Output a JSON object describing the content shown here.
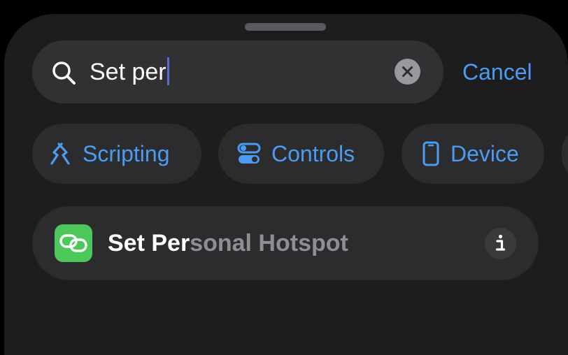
{
  "search": {
    "query": "Set per",
    "clear_icon": "xmark-circle-icon",
    "search_icon": "magnifyingglass-icon"
  },
  "header": {
    "cancel_label": "Cancel"
  },
  "categories": [
    {
      "label": "Scripting",
      "icon": "scripting-icon"
    },
    {
      "label": "Controls",
      "icon": "toggles-icon"
    },
    {
      "label": "Device",
      "icon": "phone-icon"
    }
  ],
  "results": [
    {
      "title_match": "Set Per",
      "title_rest": "sonal Hotspot",
      "icon": "link-icon",
      "info_icon": "info-icon"
    }
  ],
  "colors": {
    "accent": "#4b9cf0",
    "sheet": "#1d1d1f",
    "app_icon_green": "#4cc95a"
  }
}
